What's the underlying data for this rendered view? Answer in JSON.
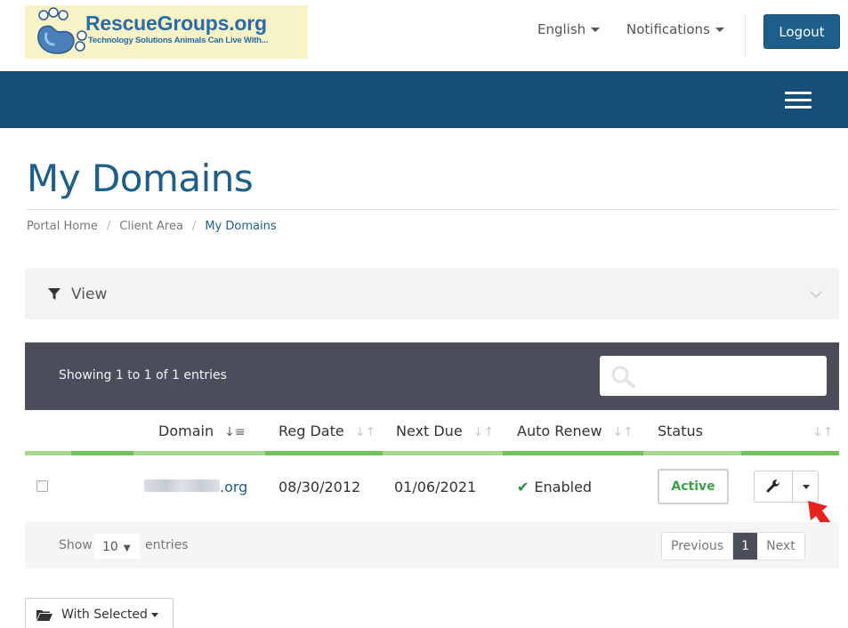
{
  "header": {
    "logo_title": "RescueGroups.org",
    "logo_tagline": "Technology Solutions Animals Can Live With...",
    "language_label": "English",
    "notifications_label": "Notifications",
    "logout_label": "Logout",
    "menu_icon": "hamburger-icon"
  },
  "page": {
    "title": "My Domains",
    "breadcrumb": [
      "Portal Home",
      "Client Area",
      "My Domains"
    ]
  },
  "view_panel": {
    "label": "View",
    "icon": "filter-icon"
  },
  "table": {
    "showing_text": "Showing 1 to 1 of 1 entries",
    "search_placeholder": "",
    "columns": [
      "Domain",
      "Reg Date",
      "Next Due",
      "Auto Renew",
      "Status"
    ],
    "rows": [
      {
        "domain_suffix": ".org",
        "reg_date": "08/30/2012",
        "next_due": "01/06/2021",
        "auto_renew": "Enabled",
        "status": "Active"
      }
    ],
    "show_label": "Show",
    "page_size": "10",
    "entries_label": "entries",
    "pagination": {
      "previous": "Previous",
      "current": "1",
      "next": "Next"
    }
  },
  "bulk": {
    "with_selected_label": "With Selected"
  },
  "colors": {
    "brand_blue": "#1d5f8a",
    "navbar_blue": "#154f79",
    "table_header": "#4a4d5a",
    "accent_green": "#6fc25a",
    "status_green": "#3aa346"
  }
}
